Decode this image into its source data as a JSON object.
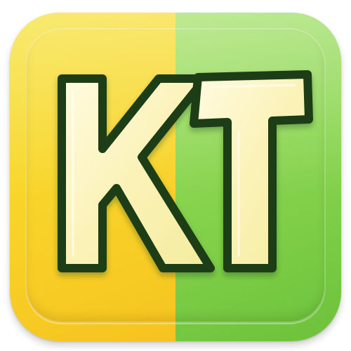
{
  "icon": {
    "monogram": "KT",
    "colors": {
      "left_background": "#f6d42a",
      "right_background": "#8ad550",
      "letter_fill": "#fbf6c8",
      "letter_outline": "#1f3d18"
    }
  }
}
